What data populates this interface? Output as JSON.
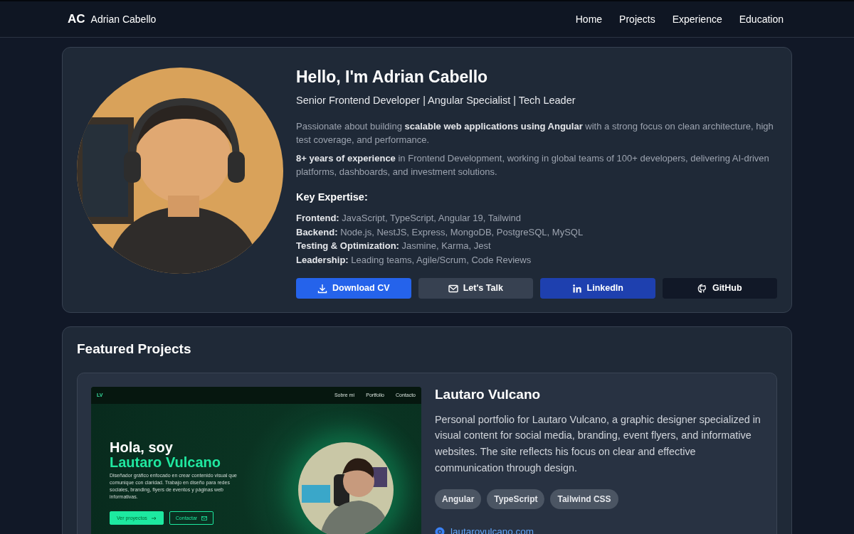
{
  "navbar": {
    "logo": "AC",
    "name": "Adrian Cabello",
    "links": [
      {
        "label": "Home"
      },
      {
        "label": "Projects"
      },
      {
        "label": "Experience"
      },
      {
        "label": "Education"
      }
    ]
  },
  "hero": {
    "avatar": {
      "kind": "picture"
    },
    "title": "Hello, I'm Adrian Cabello",
    "subtitle": "Senior Frontend Developer | Angular Specialist | Tech Leader",
    "paragraphs": [
      "Passionate about building **scalable web applications using Angular** with a strong focus on clean architecture, high test coverage, and performance.",
      "**8+ years of experience** in Frontend Development, working in global teams of 100+ developers, delivering AI-driven platforms, dashboards, and investment solutions."
    ],
    "expertise_title": "Key Expertise:",
    "expertise": [
      "**Frontend:** JavaScript, TypeScript, Angular 19, Tailwind",
      "**Backend:** Node.js, NestJS, Express, MongoDB, PostgreSQL, MySQL",
      "**Testing & Optimization:** Jasmine, Karma, Jest",
      "**Leadership:** Leading teams, Agile/Scrum, Code Reviews"
    ],
    "buttons": [
      {
        "label": "Download CV",
        "kind": "download"
      },
      {
        "label": "Let's Talk",
        "kind": "mail"
      },
      {
        "label": "LinkedIn",
        "kind": "linkedin"
      },
      {
        "label": "GitHub",
        "kind": "github"
      }
    ]
  },
  "projects": {
    "title": "Featured Projects",
    "items": [
      {
        "preview": {
          "logo": "LV",
          "nav": [
            "Sobre mí",
            "Portfolio",
            "Contacto"
          ],
          "greeting": "Hola, soy",
          "name": "Lautaro Vulcano",
          "description": "Diseñador gráfico enfocado en crear contenido visual que comunique con claridad. Trabajo en diseño para redes sociales, branding, flyers de eventos y páginas web informativas.",
          "photo": {
            "kind": "picture"
          },
          "buttons": [
            {
              "label": "Ver proyectos",
              "kind": "primary"
            },
            {
              "label": "Contactar",
              "kind": "outline"
            }
          ]
        },
        "title": "Lautaro Vulcano",
        "description": "Personal portfolio for Lautaro Vulcano, a graphic designer specialized in visual content for social media, branding, event flyers, and informative websites. The site reflects his focus on clear and effective communication through design.",
        "tags": [
          "Angular",
          "TypeScript",
          "Tailwind CSS"
        ],
        "link": "lautarovulcano.com"
      }
    ]
  }
}
